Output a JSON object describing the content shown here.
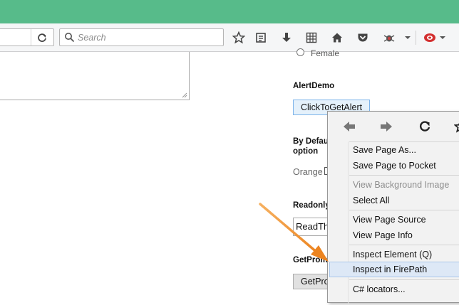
{
  "toolbar": {
    "search_placeholder": "Search",
    "icons": [
      "reload-icon",
      "search-icon",
      "bookmark-star-icon",
      "reading-list-icon",
      "download-icon",
      "apps-grid-icon",
      "home-icon",
      "pocket-icon",
      "firebug-icon",
      "ublock-icon"
    ]
  },
  "page": {
    "radio_female_label": "Female",
    "alert_demo": {
      "heading": "AlertDemo",
      "button": "ClickToGetAlert"
    },
    "default_option": {
      "heading_line1": "By Defau",
      "heading_line2": "option",
      "checkbox_label": "Orange"
    },
    "readonly": {
      "heading": "Readonly",
      "value": "ReadTh"
    },
    "get_prompt": {
      "heading": "GetPromp",
      "button": "GetPro"
    }
  },
  "context_menu": {
    "items": [
      {
        "label": "Save Page As..."
      },
      {
        "label": "Save Page to Pocket"
      },
      {
        "label": "View Background Image",
        "disabled": true
      },
      {
        "label": "Select All"
      },
      {
        "label": "View Page Source"
      },
      {
        "label": "View Page Info"
      },
      {
        "label": "Inspect Element (Q)"
      },
      {
        "label": "Inspect in FirePath",
        "highlighted": true
      },
      {
        "label": "C# locators..."
      }
    ]
  },
  "colors": {
    "title_bar": "#57bb8a",
    "annotation_arrow": "#f0912c",
    "menu_highlight": "#dde8f6"
  }
}
